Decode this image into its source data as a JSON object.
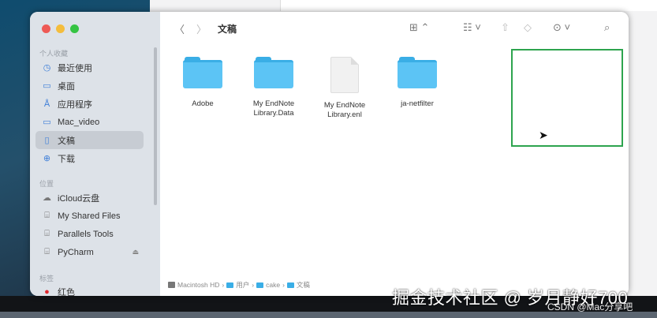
{
  "window": {
    "title": "文稿"
  },
  "sidebar": {
    "favorites_label": "个人收藏",
    "favorites": [
      {
        "label": "最近使用",
        "icon": "clock-icon"
      },
      {
        "label": "桌面",
        "icon": "desktop-icon"
      },
      {
        "label": "应用程序",
        "icon": "applications-icon"
      },
      {
        "label": "Mac_video",
        "icon": "folder-icon"
      },
      {
        "label": "文稿",
        "icon": "document-icon",
        "selected": true
      },
      {
        "label": "下载",
        "icon": "download-icon"
      }
    ],
    "locations_label": "位置",
    "locations": [
      {
        "label": "iCloud云盘",
        "icon": "cloud-icon"
      },
      {
        "label": "My Shared Files",
        "icon": "drive-icon"
      },
      {
        "label": "Parallels Tools",
        "icon": "drive-icon"
      },
      {
        "label": "PyCharm",
        "icon": "drive-icon",
        "eject": "⏏"
      }
    ],
    "tags_label": "标签",
    "tags": [
      {
        "label": "红色",
        "color": "#e0282e"
      }
    ]
  },
  "files": [
    {
      "name": "Adobe",
      "type": "folder"
    },
    {
      "name": "My EndNote Library.Data",
      "type": "folder"
    },
    {
      "name": "My EndNote Library.enl",
      "type": "document"
    },
    {
      "name": "ja-netfilter",
      "type": "folder",
      "highlighted": true
    }
  ],
  "path": [
    "Macintosh HD",
    "用户",
    "cake",
    "文稿"
  ],
  "watermark": {
    "main": "掘金技术社区 @ 岁月静好700",
    "sub": "CSDN @Mac分享吧"
  }
}
